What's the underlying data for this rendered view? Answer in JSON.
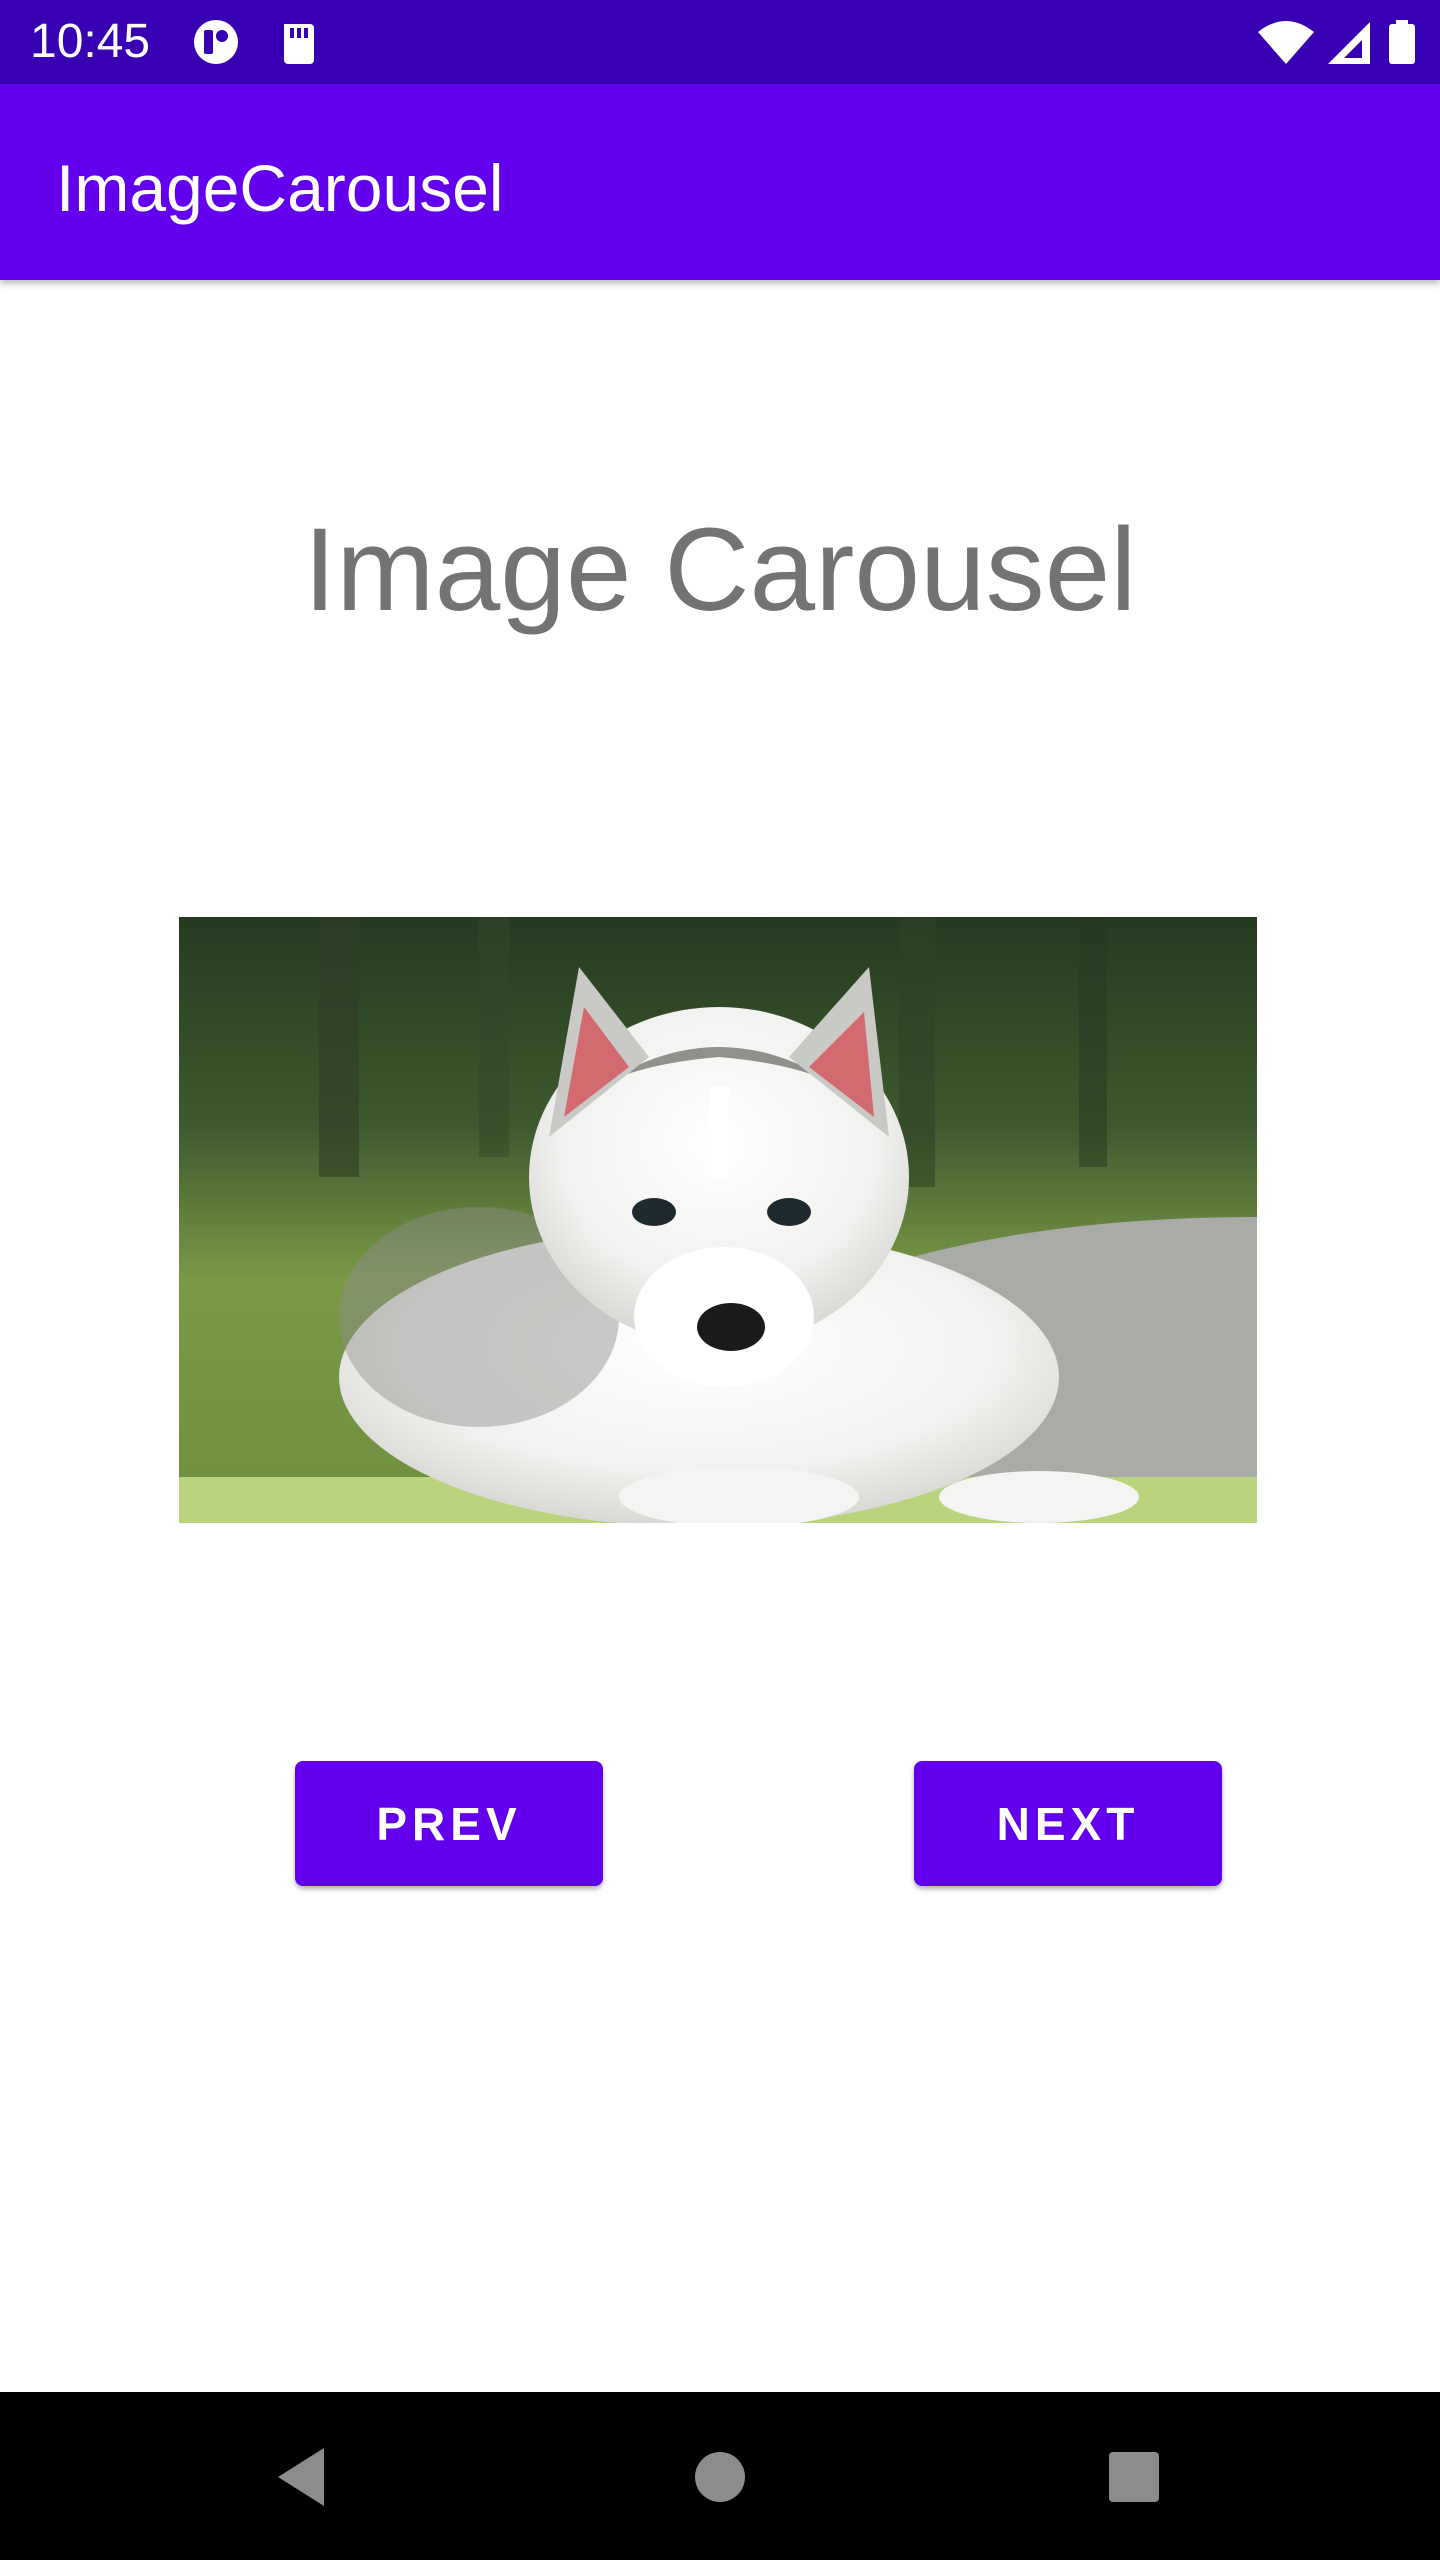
{
  "status_bar": {
    "time": "10:45",
    "left_icons": [
      "notification-app-icon",
      "sd-card-icon"
    ],
    "right_icons": [
      "wifi-icon",
      "cell-signal-icon",
      "battery-icon"
    ],
    "background": "#3700B3"
  },
  "app_bar": {
    "title": "ImageCarousel",
    "background": "#6200EE"
  },
  "main": {
    "heading": "Image Carousel",
    "image_icon": "husky-puppy-photo",
    "buttons": {
      "prev_label": "PREV",
      "next_label": "NEXT"
    },
    "accent": "#6200EE"
  },
  "nav_bar": {
    "icons": [
      "back-triangle-icon",
      "home-circle-icon",
      "recents-square-icon"
    ]
  }
}
